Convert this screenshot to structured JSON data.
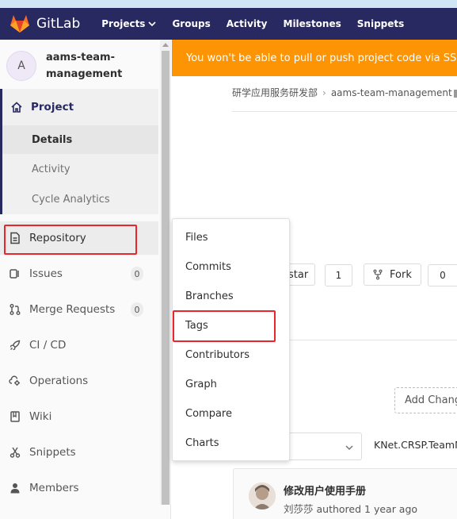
{
  "navbar": {
    "brand": "GitLab",
    "links": [
      "Projects",
      "Groups",
      "Activity",
      "Milestones",
      "Snippets"
    ]
  },
  "sidebar": {
    "avatar_letter": "A",
    "project_name": "aams-team-management",
    "project_label": "Project",
    "sub_items": [
      "Details",
      "Activity",
      "Cycle Analytics"
    ],
    "items": [
      {
        "label": "Repository",
        "icon": "document-icon"
      },
      {
        "label": "Issues",
        "icon": "issues-icon",
        "count": "0"
      },
      {
        "label": "Merge Requests",
        "icon": "merge-request-icon",
        "count": "0"
      },
      {
        "label": "CI / CD",
        "icon": "rocket-icon"
      },
      {
        "label": "Operations",
        "icon": "cloud-gear-icon"
      },
      {
        "label": "Wiki",
        "icon": "book-icon"
      },
      {
        "label": "Snippets",
        "icon": "scissors-icon"
      },
      {
        "label": "Members",
        "icon": "user-icon"
      }
    ]
  },
  "alert": {
    "text": "You won't be able to pull or push project code via SSH u"
  },
  "breadcrumb": {
    "group": "研学应用服务研发部",
    "project": "aams-team-management"
  },
  "actions": {
    "star_label": "star",
    "star_count": "1",
    "fork_label": "Fork",
    "fork_count": "0"
  },
  "repository_menu": {
    "items": [
      "Files",
      "Commits",
      "Branches",
      "Tags",
      "Contributors",
      "Graph",
      "Compare",
      "Charts"
    ]
  },
  "add_changelog": "Add Chang",
  "path": "KNet.CRSP.TeamM",
  "commit": {
    "title": "修改用户使用手册",
    "author": "刘莎莎",
    "meta": "authored 1 year ago"
  },
  "colors": {
    "navbar": "#292961",
    "alert": "#fc9403",
    "highlight": "#e8262c"
  }
}
